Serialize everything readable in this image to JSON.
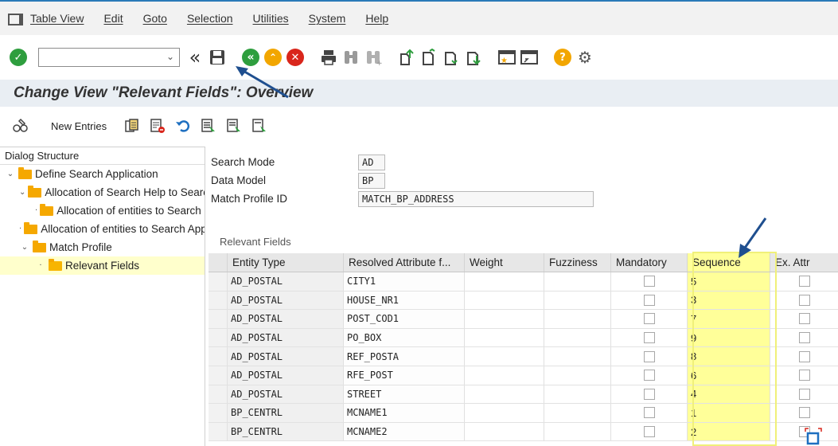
{
  "menu": {
    "items": [
      "Table View",
      "Edit",
      "Goto",
      "Selection",
      "Utilities",
      "System",
      "Help"
    ]
  },
  "toolbar": {
    "command_value": "",
    "icons": [
      "enter-icon",
      "back-double-icon",
      "save-icon",
      "back-icon",
      "exit-icon",
      "cancel-icon",
      "print-icon",
      "find-icon",
      "find-next-icon",
      "first-page-icon",
      "prev-page-icon",
      "next-page-icon",
      "last-page-icon",
      "new-session-icon",
      "shortcut-icon",
      "help-icon",
      "settings-icon"
    ]
  },
  "page": {
    "title": "Change View \"Relevant Fields\": Overview"
  },
  "app_toolbar": {
    "new_entries_label": "New Entries"
  },
  "dialog_structure": {
    "header": "Dialog Structure",
    "items": [
      {
        "label": "Define Search Application",
        "level": 0,
        "toggle": "expanded"
      },
      {
        "label": "Allocation of Search Help to Search Application",
        "level": 1,
        "toggle": "expanded"
      },
      {
        "label": "Allocation of entities to Search Help",
        "level": 2,
        "toggle": "leaf"
      },
      {
        "label": "Allocation of entities to Search Application",
        "level": 1,
        "toggle": "leaf"
      },
      {
        "label": "Match Profile",
        "level": 1,
        "toggle": "expanded"
      },
      {
        "label": "Relevant Fields",
        "level": 2,
        "toggle": "leaf",
        "selected": true
      }
    ]
  },
  "header_fields": [
    {
      "label": "Search Mode",
      "value": "AD"
    },
    {
      "label": "Data Model",
      "value": "BP"
    },
    {
      "label": "Match Profile ID",
      "value": "MATCH_BP_ADDRESS"
    }
  ],
  "relevant_fields": {
    "caption": "Relevant Fields",
    "columns": [
      "Entity Type",
      "Resolved Attribute f...",
      "Weight",
      "Fuzziness",
      "Mandatory",
      "Sequence",
      "Ex. Attr"
    ],
    "rows": [
      {
        "entity": "AD_POSTAL",
        "attribute": "CITY1",
        "weight": "",
        "fuzziness": "",
        "mandatory": false,
        "sequence": "5",
        "ex_attr": false
      },
      {
        "entity": "AD_POSTAL",
        "attribute": "HOUSE_NR1",
        "weight": "",
        "fuzziness": "",
        "mandatory": false,
        "sequence": "3",
        "ex_attr": false
      },
      {
        "entity": "AD_POSTAL",
        "attribute": "POST_COD1",
        "weight": "",
        "fuzziness": "",
        "mandatory": false,
        "sequence": "7",
        "ex_attr": false
      },
      {
        "entity": "AD_POSTAL",
        "attribute": "PO_BOX",
        "weight": "",
        "fuzziness": "",
        "mandatory": false,
        "sequence": "9",
        "ex_attr": false
      },
      {
        "entity": "AD_POSTAL",
        "attribute": "REF_POSTA",
        "weight": "",
        "fuzziness": "",
        "mandatory": false,
        "sequence": "8",
        "ex_attr": false
      },
      {
        "entity": "AD_POSTAL",
        "attribute": "RFE_POST",
        "weight": "",
        "fuzziness": "",
        "mandatory": false,
        "sequence": "6",
        "ex_attr": false
      },
      {
        "entity": "AD_POSTAL",
        "attribute": "STREET",
        "weight": "",
        "fuzziness": "",
        "mandatory": false,
        "sequence": "4",
        "ex_attr": false
      },
      {
        "entity": "BP_CENTRL",
        "attribute": "MCNAME1",
        "weight": "",
        "fuzziness": "",
        "mandatory": false,
        "sequence": "1",
        "ex_attr": false
      },
      {
        "entity": "BP_CENTRL",
        "attribute": "MCNAME2",
        "weight": "",
        "fuzziness": "",
        "mandatory": false,
        "sequence": "2",
        "ex_attr": false
      }
    ]
  },
  "colors": {
    "accent": "#2a7ab8",
    "highlight": "#ffff99",
    "annotation_arrow": "#1f4f8f",
    "folder": "#f5a800"
  }
}
